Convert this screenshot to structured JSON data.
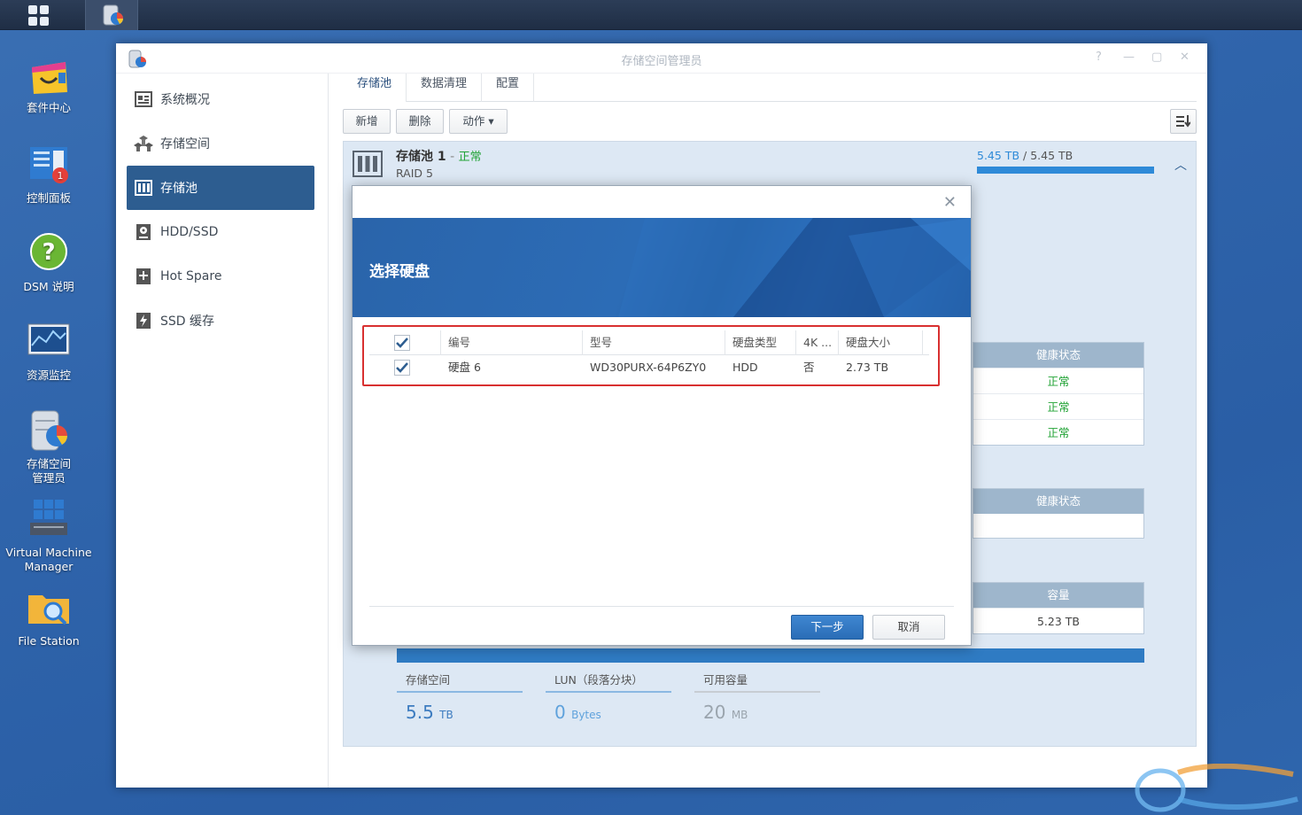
{
  "window": {
    "title": "存储空间管理员"
  },
  "desktop": {
    "icons": [
      {
        "label": "套件中心"
      },
      {
        "label": "控制面板",
        "badge": "1"
      },
      {
        "label": "DSM 说明"
      },
      {
        "label": "资源监控"
      },
      {
        "label": "存储空间\n管理员"
      },
      {
        "label": "Virtual Machine\nManager"
      },
      {
        "label": "File Station"
      }
    ]
  },
  "sidebar": {
    "items": [
      {
        "label": "系统概况"
      },
      {
        "label": "存储空间"
      },
      {
        "label": "存储池"
      },
      {
        "label": "HDD/SSD"
      },
      {
        "label": "Hot Spare"
      },
      {
        "label": "SSD 缓存"
      }
    ]
  },
  "tabs": [
    {
      "label": "存储池"
    },
    {
      "label": "数据清理"
    },
    {
      "label": "配置"
    }
  ],
  "toolbar": {
    "add": "新增",
    "delete": "删除",
    "action": "动作 ▾"
  },
  "pool": {
    "name": "存储池 1",
    "sep": " - ",
    "status": "正常",
    "raid": "RAID 5",
    "used": "5.45 TB",
    "total": "5.45 TB",
    "health_header": "健康状态",
    "health_rows": [
      "正常",
      "正常",
      "正常"
    ],
    "health_header2": "健康状态",
    "capacity_header": "容量",
    "capacity_value": "5.23 TB",
    "stats": [
      {
        "label": "存储空间",
        "value": "5.5",
        "unit": "TB"
      },
      {
        "label": "LUN（段落分块）",
        "value": "0",
        "unit": "Bytes"
      },
      {
        "label": "可用容量",
        "value": "20",
        "unit": "MB"
      }
    ]
  },
  "modal": {
    "title": "选择硬盘",
    "columns": [
      "编号",
      "型号",
      "硬盘类型",
      "4K ...",
      "硬盘大小"
    ],
    "rows": [
      {
        "id": "硬盘 6",
        "model": "WD30PURX-64P6ZY0",
        "type": "HDD",
        "k4": "否",
        "size": "2.73 TB"
      }
    ],
    "next": "下一步",
    "cancel": "取消"
  },
  "colors": {
    "accent": "#2d5d90",
    "ok": "#22a336",
    "alert": "#d83030"
  }
}
